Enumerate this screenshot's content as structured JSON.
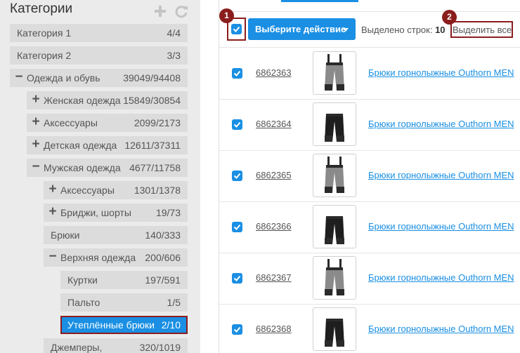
{
  "categories_panel": {
    "title": "Категории",
    "tools": [
      "plus-icon",
      "refresh-icon"
    ],
    "items": [
      {
        "label": "Категория 1",
        "count": "4/4",
        "sign": ""
      },
      {
        "label": "Категория 2",
        "count": "3/3",
        "sign": ""
      },
      {
        "label": "Одежда и обувь",
        "count": "39049/94408",
        "sign": "−"
      },
      {
        "label": "Женская одежда",
        "count": "15849/30854",
        "sign": "+"
      },
      {
        "label": "Аксессуары",
        "count": "2099/2173",
        "sign": "+"
      },
      {
        "label": "Детская одежда",
        "count": "12611/37311",
        "sign": "+"
      },
      {
        "label": "Мужская одежда",
        "count": "4677/11758",
        "sign": "−"
      },
      {
        "label": "Аксессуары",
        "count": "1301/1378",
        "sign": "+"
      },
      {
        "label": "Бриджи, шорты",
        "count": "19/73",
        "sign": "+"
      },
      {
        "label": "Брюки",
        "count": "140/333",
        "sign": ""
      },
      {
        "label": "Верхняя одежда",
        "count": "200/606",
        "sign": "−"
      },
      {
        "label": "Куртки",
        "count": "197/591",
        "sign": ""
      },
      {
        "label": "Пальто",
        "count": "1/5",
        "sign": ""
      },
      {
        "label": "Утеплённые брюки",
        "count": "2/10",
        "sign": "",
        "selected": true
      },
      {
        "label": "Джемперы,",
        "count": "320/1019",
        "sign": ""
      }
    ]
  },
  "toolbar": {
    "action_button": "Выберите действие",
    "selected_label": "Выделено строк:",
    "selected_count": "10",
    "select_all": "Выделить все",
    "badge_1": "1",
    "badge_2": "2"
  },
  "products": [
    {
      "id": "6862363",
      "name": "Брюки горнолыжные Outhorn MEN",
      "variant": "grey"
    },
    {
      "id": "6862364",
      "name": "Брюки горнолыжные Outhorn MEN",
      "variant": "black"
    },
    {
      "id": "6862365",
      "name": "Брюки горнолыжные Outhorn MEN",
      "variant": "grey"
    },
    {
      "id": "6862366",
      "name": "Брюки горнолыжные Outhorn MEN",
      "variant": "black"
    },
    {
      "id": "6862367",
      "name": "Брюки горнолыжные Outhorn MEN",
      "variant": "grey"
    },
    {
      "id": "6862368",
      "name": "Брюки горнолыжные Outhorn MEN",
      "variant": "black"
    }
  ],
  "colors": {
    "accent": "#1a8fe3",
    "highlight": "#8b1d1d",
    "panel": "#ebebeb",
    "item": "#dcdcdc"
  }
}
